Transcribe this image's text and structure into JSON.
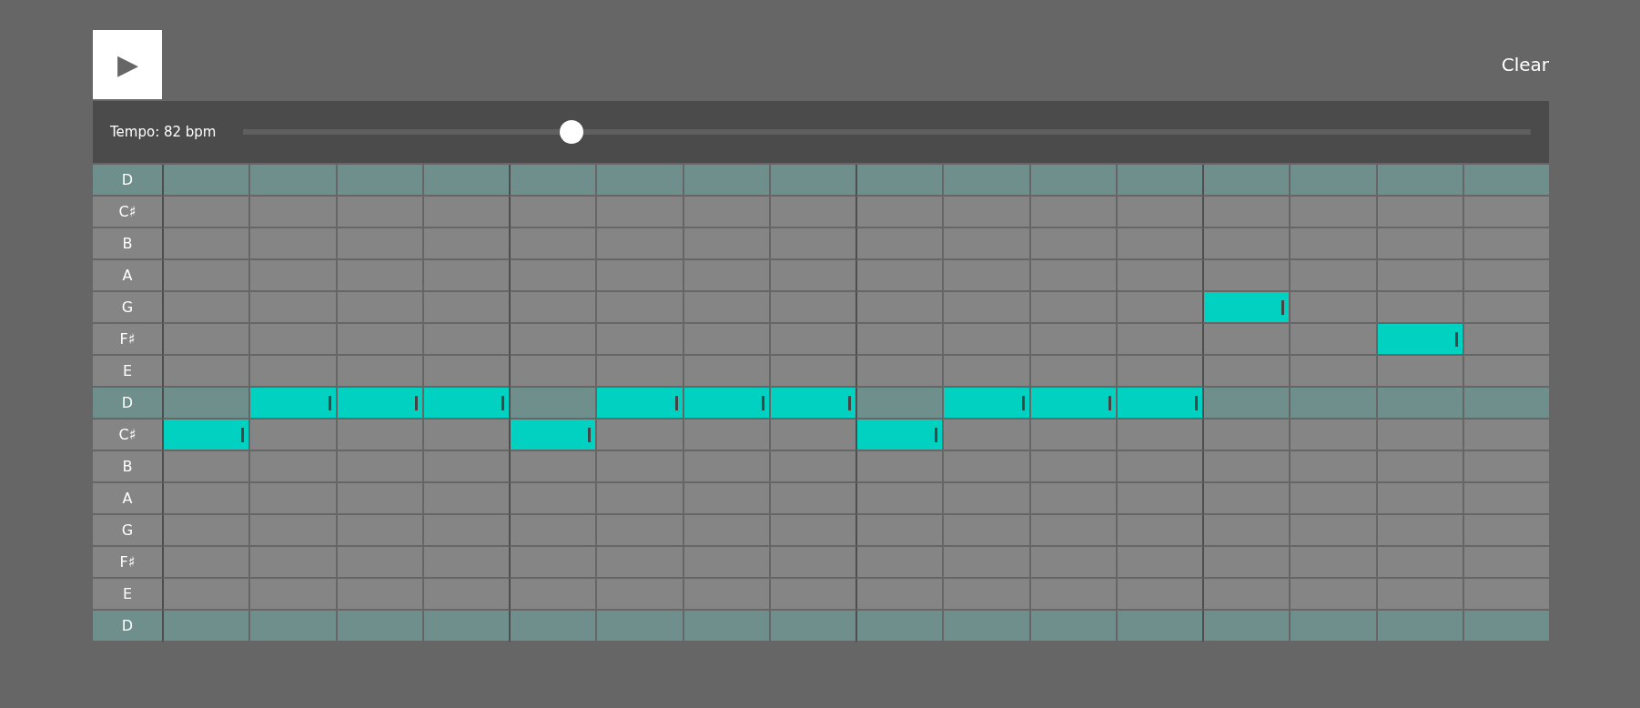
{
  "play_button": {
    "label": "▶"
  },
  "clear_button": {
    "label": "Clear"
  },
  "tempo": {
    "label": "Tempo: 82 bpm",
    "level": 0.25
  },
  "rows": [
    {
      "label": "D",
      "root": true,
      "on": [
        false,
        false,
        false,
        false,
        false,
        false,
        false,
        false,
        false,
        false,
        false,
        false,
        false,
        false,
        false,
        false
      ]
    },
    {
      "label": "C♯",
      "root": false,
      "on": [
        false,
        false,
        false,
        false,
        false,
        false,
        false,
        false,
        false,
        false,
        false,
        false,
        false,
        false,
        false,
        false
      ]
    },
    {
      "label": "B",
      "root": false,
      "on": [
        false,
        false,
        false,
        false,
        false,
        false,
        false,
        false,
        false,
        false,
        false,
        false,
        false,
        false,
        false,
        false
      ]
    },
    {
      "label": "A",
      "root": false,
      "on": [
        false,
        false,
        false,
        false,
        false,
        false,
        false,
        false,
        false,
        false,
        false,
        false,
        false,
        false,
        false,
        false
      ]
    },
    {
      "label": "G",
      "root": false,
      "on": [
        false,
        false,
        false,
        false,
        false,
        false,
        false,
        false,
        false,
        false,
        false,
        false,
        true,
        false,
        false,
        false
      ]
    },
    {
      "label": "F♯",
      "root": false,
      "on": [
        false,
        false,
        false,
        false,
        false,
        false,
        false,
        false,
        false,
        false,
        false,
        false,
        false,
        false,
        true,
        false
      ]
    },
    {
      "label": "E",
      "root": false,
      "on": [
        false,
        false,
        false,
        false,
        false,
        false,
        false,
        false,
        false,
        false,
        false,
        false,
        false,
        false,
        false,
        false
      ]
    },
    {
      "label": "D",
      "root": true,
      "on": [
        false,
        true,
        true,
        true,
        false,
        true,
        true,
        true,
        false,
        true,
        true,
        true,
        false,
        false,
        false,
        false
      ]
    },
    {
      "label": "C♯",
      "root": false,
      "on": [
        true,
        false,
        false,
        false,
        true,
        false,
        false,
        false,
        true,
        false,
        false,
        false,
        false,
        false,
        false,
        false
      ]
    },
    {
      "label": "B",
      "root": false,
      "on": [
        false,
        false,
        false,
        false,
        false,
        false,
        false,
        false,
        false,
        false,
        false,
        false,
        false,
        false,
        false,
        false
      ]
    },
    {
      "label": "A",
      "root": false,
      "on": [
        false,
        false,
        false,
        false,
        false,
        false,
        false,
        false,
        false,
        false,
        false,
        false,
        false,
        false,
        false,
        false
      ]
    },
    {
      "label": "G",
      "root": false,
      "on": [
        false,
        false,
        false,
        false,
        false,
        false,
        false,
        false,
        false,
        false,
        false,
        false,
        false,
        false,
        false,
        false
      ]
    },
    {
      "label": "F♯",
      "root": false,
      "on": [
        false,
        false,
        false,
        false,
        false,
        false,
        false,
        false,
        false,
        false,
        false,
        false,
        false,
        false,
        false,
        false
      ]
    },
    {
      "label": "E",
      "root": false,
      "on": [
        false,
        false,
        false,
        false,
        false,
        false,
        false,
        false,
        false,
        false,
        false,
        false,
        false,
        false,
        false,
        false
      ]
    },
    {
      "label": "D",
      "root": true,
      "on": [
        false,
        false,
        false,
        false,
        false,
        false,
        false,
        false,
        false,
        false,
        false,
        false,
        false,
        false,
        false,
        false
      ]
    }
  ]
}
